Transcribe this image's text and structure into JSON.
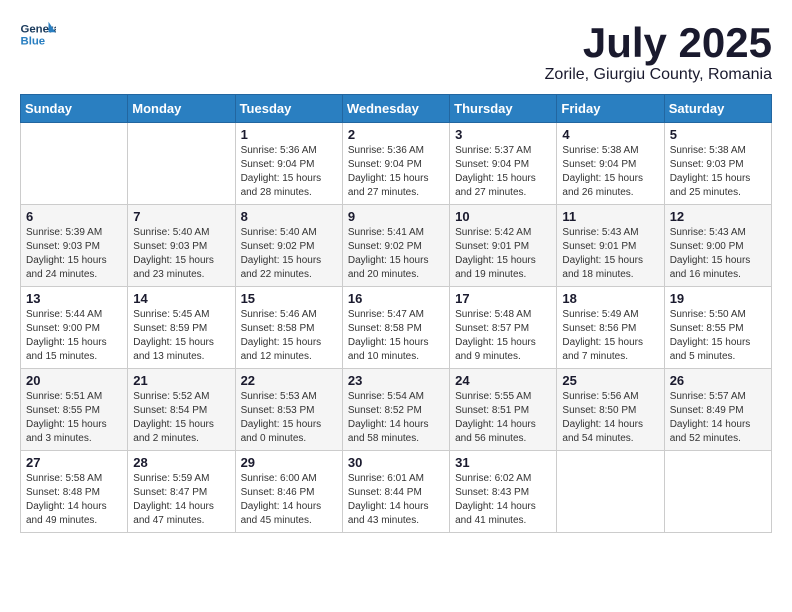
{
  "header": {
    "logo_line1": "General",
    "logo_line2": "Blue",
    "month": "July 2025",
    "location": "Zorile, Giurgiu County, Romania"
  },
  "weekdays": [
    "Sunday",
    "Monday",
    "Tuesday",
    "Wednesday",
    "Thursday",
    "Friday",
    "Saturday"
  ],
  "weeks": [
    [
      {
        "day": "",
        "info": ""
      },
      {
        "day": "",
        "info": ""
      },
      {
        "day": "1",
        "info": "Sunrise: 5:36 AM\nSunset: 9:04 PM\nDaylight: 15 hours\nand 28 minutes."
      },
      {
        "day": "2",
        "info": "Sunrise: 5:36 AM\nSunset: 9:04 PM\nDaylight: 15 hours\nand 27 minutes."
      },
      {
        "day": "3",
        "info": "Sunrise: 5:37 AM\nSunset: 9:04 PM\nDaylight: 15 hours\nand 27 minutes."
      },
      {
        "day": "4",
        "info": "Sunrise: 5:38 AM\nSunset: 9:04 PM\nDaylight: 15 hours\nand 26 minutes."
      },
      {
        "day": "5",
        "info": "Sunrise: 5:38 AM\nSunset: 9:03 PM\nDaylight: 15 hours\nand 25 minutes."
      }
    ],
    [
      {
        "day": "6",
        "info": "Sunrise: 5:39 AM\nSunset: 9:03 PM\nDaylight: 15 hours\nand 24 minutes."
      },
      {
        "day": "7",
        "info": "Sunrise: 5:40 AM\nSunset: 9:03 PM\nDaylight: 15 hours\nand 23 minutes."
      },
      {
        "day": "8",
        "info": "Sunrise: 5:40 AM\nSunset: 9:02 PM\nDaylight: 15 hours\nand 22 minutes."
      },
      {
        "day": "9",
        "info": "Sunrise: 5:41 AM\nSunset: 9:02 PM\nDaylight: 15 hours\nand 20 minutes."
      },
      {
        "day": "10",
        "info": "Sunrise: 5:42 AM\nSunset: 9:01 PM\nDaylight: 15 hours\nand 19 minutes."
      },
      {
        "day": "11",
        "info": "Sunrise: 5:43 AM\nSunset: 9:01 PM\nDaylight: 15 hours\nand 18 minutes."
      },
      {
        "day": "12",
        "info": "Sunrise: 5:43 AM\nSunset: 9:00 PM\nDaylight: 15 hours\nand 16 minutes."
      }
    ],
    [
      {
        "day": "13",
        "info": "Sunrise: 5:44 AM\nSunset: 9:00 PM\nDaylight: 15 hours\nand 15 minutes."
      },
      {
        "day": "14",
        "info": "Sunrise: 5:45 AM\nSunset: 8:59 PM\nDaylight: 15 hours\nand 13 minutes."
      },
      {
        "day": "15",
        "info": "Sunrise: 5:46 AM\nSunset: 8:58 PM\nDaylight: 15 hours\nand 12 minutes."
      },
      {
        "day": "16",
        "info": "Sunrise: 5:47 AM\nSunset: 8:58 PM\nDaylight: 15 hours\nand 10 minutes."
      },
      {
        "day": "17",
        "info": "Sunrise: 5:48 AM\nSunset: 8:57 PM\nDaylight: 15 hours\nand 9 minutes."
      },
      {
        "day": "18",
        "info": "Sunrise: 5:49 AM\nSunset: 8:56 PM\nDaylight: 15 hours\nand 7 minutes."
      },
      {
        "day": "19",
        "info": "Sunrise: 5:50 AM\nSunset: 8:55 PM\nDaylight: 15 hours\nand 5 minutes."
      }
    ],
    [
      {
        "day": "20",
        "info": "Sunrise: 5:51 AM\nSunset: 8:55 PM\nDaylight: 15 hours\nand 3 minutes."
      },
      {
        "day": "21",
        "info": "Sunrise: 5:52 AM\nSunset: 8:54 PM\nDaylight: 15 hours\nand 2 minutes."
      },
      {
        "day": "22",
        "info": "Sunrise: 5:53 AM\nSunset: 8:53 PM\nDaylight: 15 hours\nand 0 minutes."
      },
      {
        "day": "23",
        "info": "Sunrise: 5:54 AM\nSunset: 8:52 PM\nDaylight: 14 hours\nand 58 minutes."
      },
      {
        "day": "24",
        "info": "Sunrise: 5:55 AM\nSunset: 8:51 PM\nDaylight: 14 hours\nand 56 minutes."
      },
      {
        "day": "25",
        "info": "Sunrise: 5:56 AM\nSunset: 8:50 PM\nDaylight: 14 hours\nand 54 minutes."
      },
      {
        "day": "26",
        "info": "Sunrise: 5:57 AM\nSunset: 8:49 PM\nDaylight: 14 hours\nand 52 minutes."
      }
    ],
    [
      {
        "day": "27",
        "info": "Sunrise: 5:58 AM\nSunset: 8:48 PM\nDaylight: 14 hours\nand 49 minutes."
      },
      {
        "day": "28",
        "info": "Sunrise: 5:59 AM\nSunset: 8:47 PM\nDaylight: 14 hours\nand 47 minutes."
      },
      {
        "day": "29",
        "info": "Sunrise: 6:00 AM\nSunset: 8:46 PM\nDaylight: 14 hours\nand 45 minutes."
      },
      {
        "day": "30",
        "info": "Sunrise: 6:01 AM\nSunset: 8:44 PM\nDaylight: 14 hours\nand 43 minutes."
      },
      {
        "day": "31",
        "info": "Sunrise: 6:02 AM\nSunset: 8:43 PM\nDaylight: 14 hours\nand 41 minutes."
      },
      {
        "day": "",
        "info": ""
      },
      {
        "day": "",
        "info": ""
      }
    ]
  ]
}
